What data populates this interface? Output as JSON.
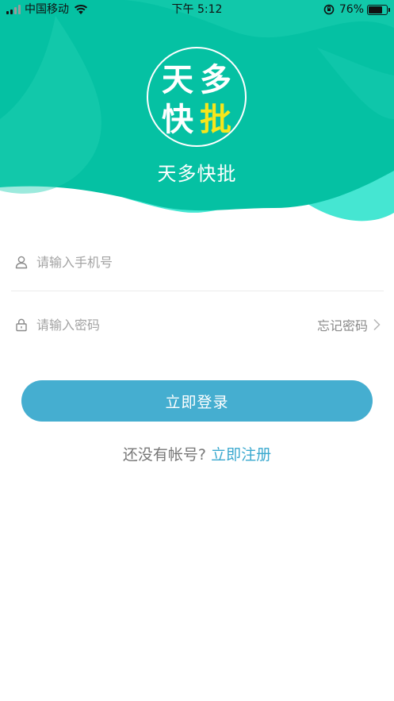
{
  "status_bar": {
    "carrier": "中国移动",
    "time": "下午 5:12",
    "battery_percent": "76%",
    "battery_level": 0.76,
    "icons": [
      "signal-icon",
      "wifi-icon",
      "orientation-lock-icon",
      "battery-icon"
    ]
  },
  "header": {
    "logo_chars": [
      "天",
      "多",
      "快",
      "批"
    ],
    "app_name": "天多快批",
    "colors": {
      "primary": "#05c1a3",
      "light": "#45e6d2",
      "logo_accent": "#f7e61b"
    }
  },
  "form": {
    "phone": {
      "placeholder": "请输入手机号",
      "value": "",
      "icon": "user-icon"
    },
    "password": {
      "placeholder": "请输入密码",
      "value": "",
      "icon": "lock-icon"
    },
    "forgot_password": "忘记密码",
    "login_label": "立即登录",
    "login_color": "#45aed0"
  },
  "register": {
    "prompt": "还没有帐号?",
    "link": "立即注册"
  }
}
